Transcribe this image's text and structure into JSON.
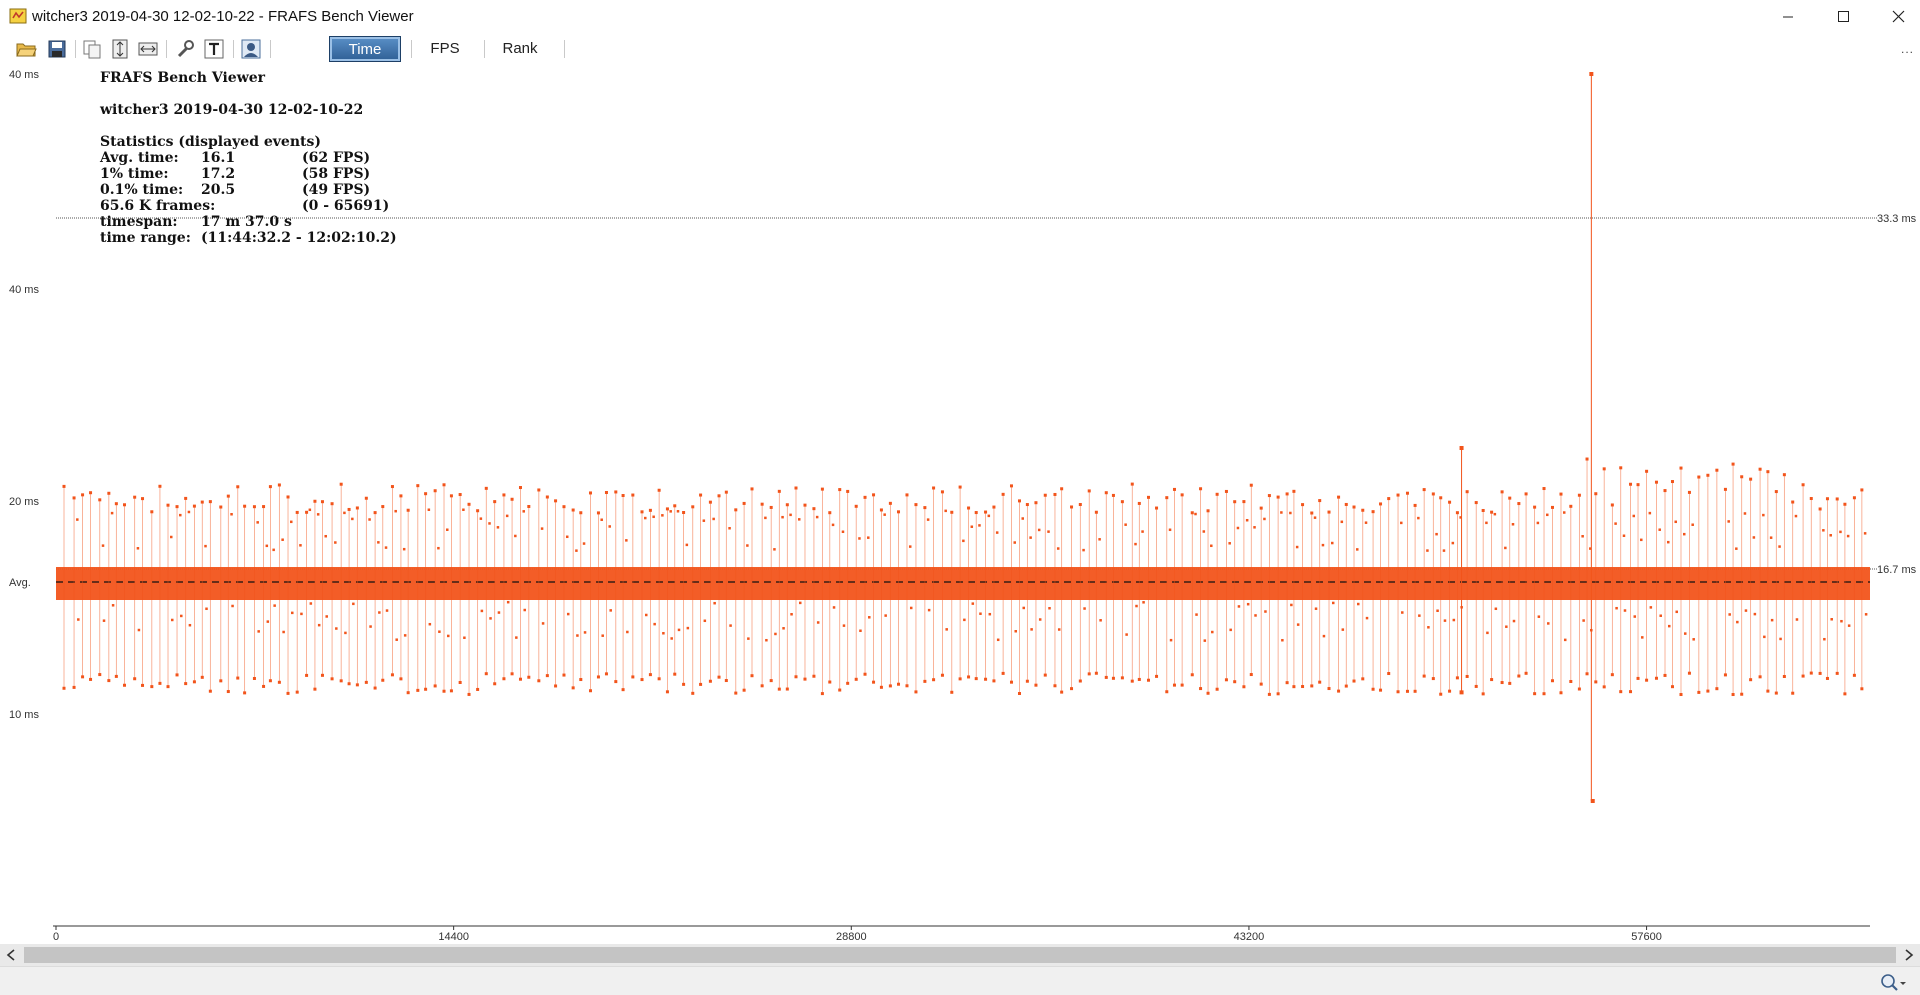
{
  "window": {
    "title": "witcher3 2019-04-30 12-02-10-22 - FRAFS Bench Viewer",
    "controls": [
      "minimize",
      "maximize",
      "close"
    ]
  },
  "toolbar": {
    "icons": [
      "open-folder-icon",
      "save-icon",
      "copy-icon",
      "fit-vertical-icon",
      "fit-horizontal-icon",
      "settings-wrench-icon",
      "text-icon",
      "user-profile-icon"
    ],
    "tabs": [
      {
        "label": "Time",
        "active": true
      },
      {
        "label": "FPS",
        "active": false
      },
      {
        "label": "Rank",
        "active": false
      }
    ],
    "more": "..."
  },
  "stats": {
    "app_name": "FRAFS Bench Viewer",
    "file_name": "witcher3 2019-04-30 12-02-10-22",
    "heading": "Statistics (displayed events)",
    "rows": [
      {
        "label": "Avg. time:",
        "value": "16.1",
        "extra": "(62 FPS)"
      },
      {
        "label": "1% time:",
        "value": "17.2",
        "extra": "(58 FPS)"
      },
      {
        "label": "0.1% time:",
        "value": "20.5",
        "extra": "(49 FPS)"
      },
      {
        "label": "65.6 K frames:",
        "value": "",
        "extra": "(0 - 65691)"
      },
      {
        "label": "timespan:",
        "value": "17 m 37.0 s",
        "extra": ""
      },
      {
        "label": "time range:",
        "value": "(11:44:32.2 - 12:02:10.2)",
        "extra": ""
      }
    ]
  },
  "chart_data": {
    "type": "scatter",
    "x_range": [
      0,
      65691
    ],
    "x_ticks": [
      0,
      14400,
      28800,
      43200,
      57600
    ],
    "y_tick_labels": [
      {
        "label": "40 ms",
        "value": 40
      },
      {
        "label": "40 ms",
        "value": 30
      },
      {
        "label": "20 ms",
        "value": 20
      },
      {
        "label": "Avg.",
        "value": 16.1
      },
      {
        "label": "10 ms",
        "value": 10
      }
    ],
    "reference_lines": [
      {
        "label": "33.3 ms",
        "value": 33.3
      },
      {
        "label": "16.7 ms",
        "value": 16.7
      }
    ],
    "average": 16.1,
    "series_color": "#f2541b",
    "outliers": [
      {
        "x": 50900,
        "y": 22.5
      },
      {
        "x": 50900,
        "y": 11.0
      },
      {
        "x": 55600,
        "y": 40.0
      },
      {
        "x": 55650,
        "y": 6.0
      }
    ]
  },
  "colors": {
    "series": "#f2541b",
    "tab_active": "#3b6ea5",
    "background": "#ffffff"
  },
  "statusbar": {
    "icons": [
      "zoom-icon"
    ]
  }
}
